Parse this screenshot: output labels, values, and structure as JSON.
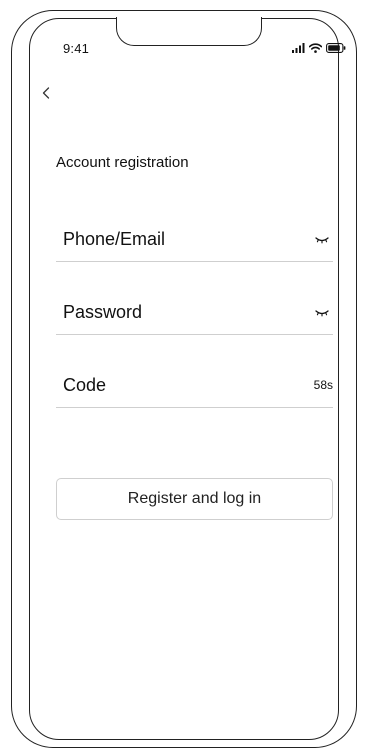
{
  "status_bar": {
    "time": "9:41",
    "icons": [
      "signal-icon",
      "wifi-icon",
      "battery-icon"
    ]
  },
  "nav": {
    "back_icon": "chevron-left-icon"
  },
  "page": {
    "title": "Account registration"
  },
  "form": {
    "phone_email": {
      "value": "",
      "placeholder": "Phone/Email",
      "toggle_icon": "eye-closed-icon"
    },
    "password": {
      "value": "",
      "placeholder": "Password",
      "toggle_icon": "eye-closed-icon"
    },
    "code": {
      "value": "",
      "placeholder": "Code",
      "countdown": "58s"
    },
    "submit_label": "Register and log in"
  },
  "colors": {
    "frame": "#222222",
    "divider": "#cfcfcf",
    "text": "#111111",
    "background": "#ffffff"
  }
}
